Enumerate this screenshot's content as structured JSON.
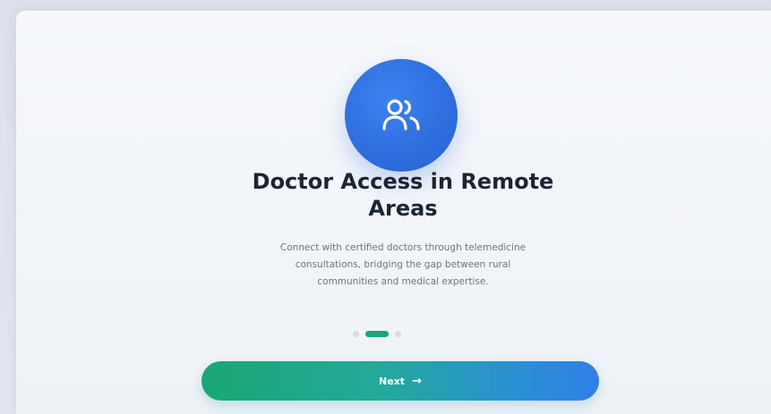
{
  "onboarding": {
    "icon": "users-icon",
    "title_line1": "Doctor Access in Remote",
    "title_line2": "Areas",
    "description_line1": "Connect with certified doctors through telemedicine",
    "description_line2": "consultations, bridging the gap between rural",
    "description_line3": "communities and medical expertise.",
    "pagination": {
      "total": 3,
      "current": 2
    },
    "next_label": "Next",
    "next_icon": "arrow-right-icon"
  },
  "colors": {
    "accent_blue": "#2f6fe0",
    "accent_green": "#17a67a",
    "title": "#1d2533",
    "body_text": "#6d7482"
  }
}
